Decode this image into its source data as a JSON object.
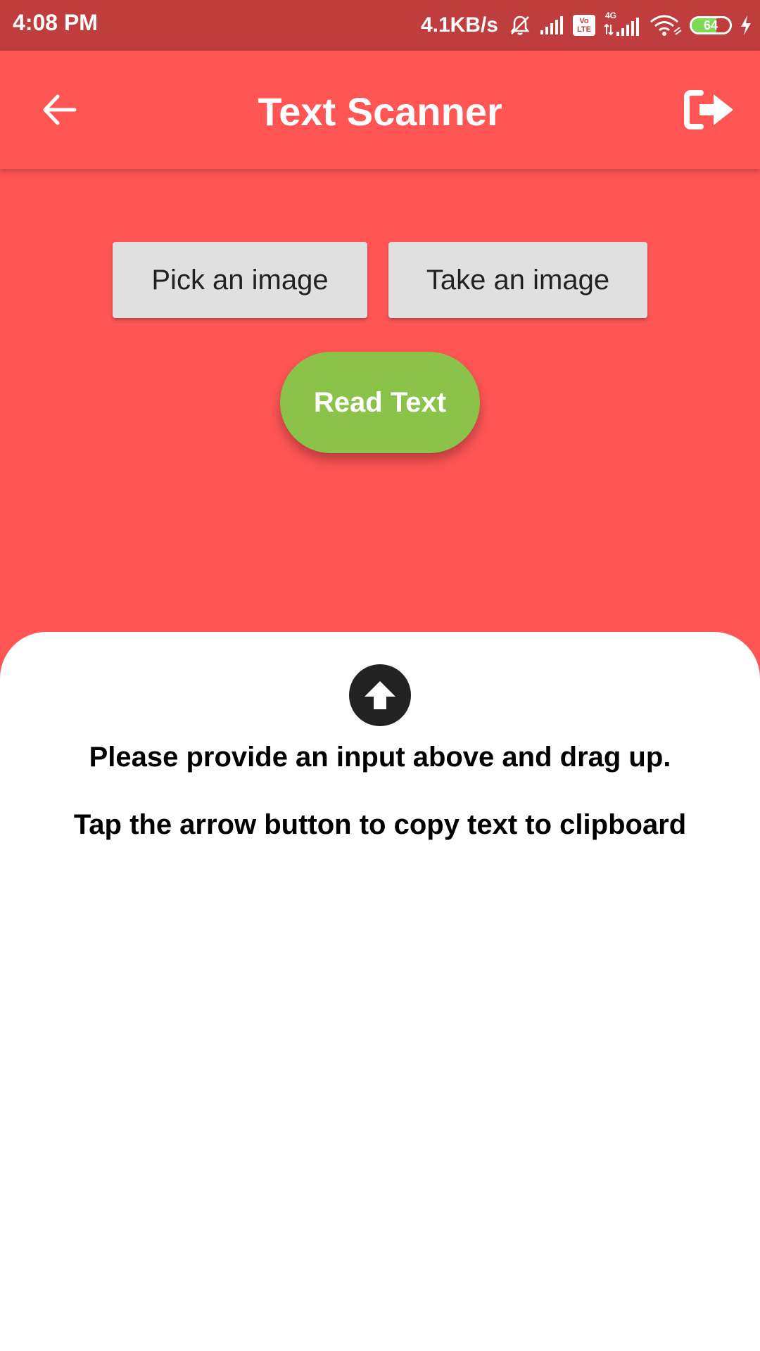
{
  "status_bar": {
    "time": "4:08 PM",
    "net_speed": "4.1KB/s",
    "icons": [
      "muted-bell-icon",
      "signal-icon",
      "volte-icon",
      "4g-signal-icon",
      "wifi-icon",
      "battery-icon",
      "charging-icon"
    ],
    "volte_top": "Vo",
    "volte_bottom": "LTE",
    "network_type": "4G",
    "battery_level": "64",
    "battery_fraction": 0.64
  },
  "app_bar": {
    "title": "Text Scanner",
    "back_icon": "arrow-left-icon",
    "exit_icon": "sign-out-icon"
  },
  "actions": {
    "pick_label": "Pick an image",
    "take_label": "Take an image",
    "read_label": "Read Text"
  },
  "sheet": {
    "arrow_icon": "arrow-up-circle-icon",
    "hint_primary": "Please provide an input above and drag up.",
    "hint_secondary": "Tap the arrow button to copy text to clipboard"
  },
  "colors": {
    "primary": "#ff5555",
    "status_bar": "#c03d3d",
    "read_button": "#8bc34a",
    "secondary_button": "#e0e0e0",
    "sheet": "#ffffff"
  }
}
